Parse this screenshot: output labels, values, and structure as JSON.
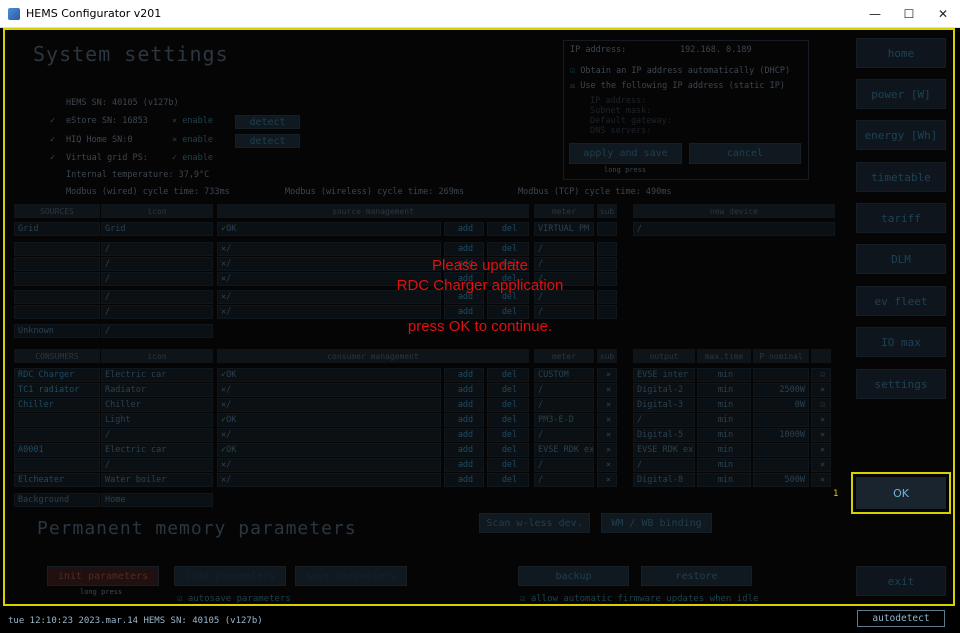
{
  "window": {
    "title": "HEMS Configurator v201",
    "minimize": "—",
    "maximize": "☐",
    "close": "✕"
  },
  "system": {
    "heading": "System settings",
    "hems_sn": "HEMS SN:    40105 (v127b)",
    "estore": "eStore SN:   16853",
    "hiq": "HIQ Home SN:0",
    "vgrid": "Virtual grid PS:",
    "enable": "enable",
    "detect": "detect",
    "temp": "Internal temperature: 37,9°C",
    "cyc_wired": "Modbus (wired) cycle time: 733ms",
    "cyc_wireless": "Modbus (wireless) cycle time: 269ms",
    "cyc_tcp": "Modbus (TCP) cycle time: 490ms"
  },
  "network": {
    "ip_label": "IP address:",
    "ip_value": "192.168.  0.189",
    "dhcp": "Obtain an IP address automatically (DHCP)",
    "static": "Use the following IP address (static IP)",
    "f_ip": "IP address:",
    "f_mask": "Subnet mask:",
    "f_gw": "Default gateway:",
    "f_dns": "DNS servers:",
    "apply": "apply and save",
    "cancel": "cancel",
    "longpress": "long press"
  },
  "sources": {
    "h_sources": "SOURCES",
    "h_icon": "icon",
    "h_mgmt": "source management",
    "h_meter": "meter",
    "h_sub": "sub",
    "h_new": "new device",
    "rows": [
      {
        "name": "Grid",
        "icon": "Grid",
        "mg": "OK",
        "meter": "VIRTUAL PM"
      },
      {
        "name": "",
        "icon": "/",
        "mg": "/",
        "meter": "/"
      },
      {
        "name": "",
        "icon": "/",
        "mg": "/",
        "meter": "/"
      },
      {
        "name": "",
        "icon": "/",
        "mg": "/",
        "meter": "/"
      },
      {
        "name": "",
        "icon": "/",
        "mg": "/",
        "meter": "/"
      },
      {
        "name": "",
        "icon": "/",
        "mg": "/",
        "meter": "/"
      }
    ],
    "unknown": "Unknown",
    "add": "add",
    "del": "del",
    "new_val": "/"
  },
  "consumers": {
    "h_cons": "CONSUMERS",
    "h_icon": "icon",
    "h_mgmt": "consumer management",
    "h_meter": "meter",
    "h_sub": "sub",
    "h_out": "output",
    "h_max": "max.time",
    "h_pnom": "P nominal",
    "rows": [
      {
        "name": "RDC Charger",
        "icon": "Electric car",
        "mg": "OK",
        "meter": "CUSTOM",
        "out": "EVSE inter",
        "mt": "min",
        "pn": ""
      },
      {
        "name": "TC1 radiator",
        "icon": "Radiator",
        "mg": "/",
        "meter": "/",
        "out": "Digital-2",
        "mt": "min",
        "pn": "2500W"
      },
      {
        "name": "Chiller",
        "icon": "Chiller",
        "mg": "/",
        "meter": "/",
        "out": "Digital-3",
        "mt": "min",
        "pn": "0W"
      },
      {
        "name": "",
        "icon": "Light",
        "mg": "OK",
        "meter": "PM3-E-D",
        "out": "/",
        "mt": "min",
        "pn": ""
      },
      {
        "name": "",
        "icon": "/",
        "mg": "/",
        "meter": "/",
        "out": "Digital-5",
        "mt": "min",
        "pn": "1000W"
      },
      {
        "name": "A0001",
        "icon": "Electric car",
        "mg": "OK",
        "meter": "EVSE RDK ex",
        "out": "EVSE RDK ex",
        "mt": "min",
        "pn": ""
      },
      {
        "name": "",
        "icon": "/",
        "mg": "/",
        "meter": "/",
        "out": "/",
        "mt": "min",
        "pn": ""
      },
      {
        "name": "Elcheater",
        "icon": "Water boiler",
        "mg": "/",
        "meter": "/",
        "out": "Digital-8",
        "mt": "min",
        "pn": "500W"
      }
    ],
    "bg_name": "Background",
    "bg_icon": "Home"
  },
  "memory": {
    "heading": "Permanent memory parameters",
    "init": "init parameters",
    "load": "load parameters",
    "save": "save parameters",
    "longpress": "long press",
    "autosave": "autosave parameters",
    "backup": "backup",
    "restore": "restore",
    "auto_fw": "allow automatic firmware updates when idle",
    "scan": "Scan w-less dev.",
    "binding": "WM / WB binding"
  },
  "nav": [
    "home",
    "power [W]",
    "energy [Wh]",
    "timetable",
    "tariff",
    "DLM",
    "ev fleet",
    "IO max",
    "settings",
    "exit"
  ],
  "dialog": {
    "line1": "Please update",
    "line2": "RDC Charger application",
    "line3": "press OK to continue.",
    "ok": "OK",
    "ok_index": "1"
  },
  "status": {
    "text": "tue 12:10:23 2023.mar.14    HEMS SN: 40105 (v127b)",
    "autodetect": "autodetect"
  }
}
